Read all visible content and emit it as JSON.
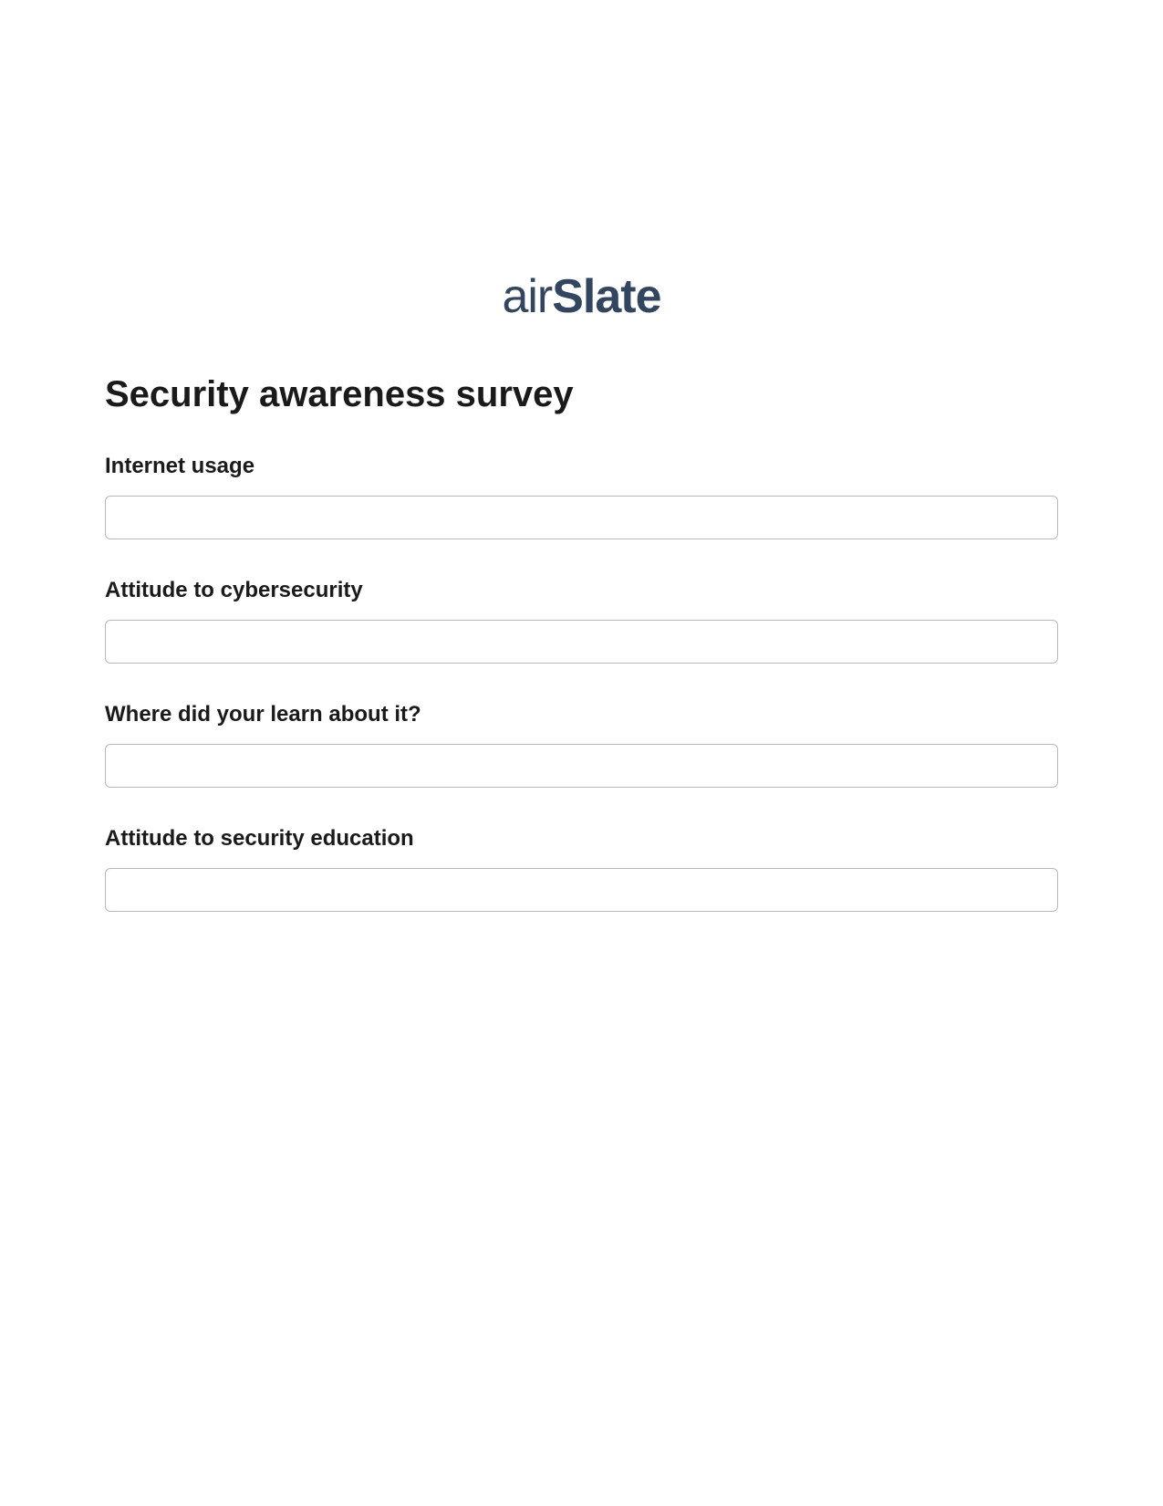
{
  "logo": {
    "prefix": "air",
    "suffix": "Slate"
  },
  "title": "Security awareness survey",
  "fields": [
    {
      "label": "Internet usage",
      "value": ""
    },
    {
      "label": "Attitude to cybersecurity",
      "value": ""
    },
    {
      "label": "Where did your learn about it?",
      "value": ""
    },
    {
      "label": "Attitude to security education",
      "value": ""
    }
  ]
}
